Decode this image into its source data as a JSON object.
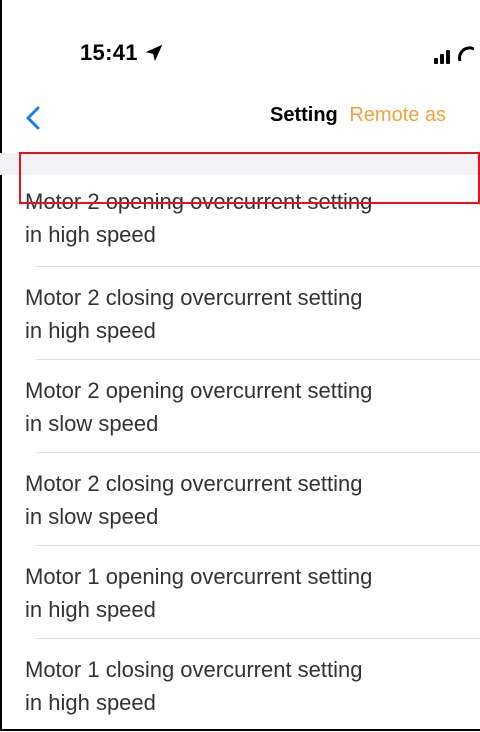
{
  "status_bar": {
    "time": "15:41",
    "location_icon": "location-arrow-icon",
    "signal_icon": "cellular-signal-icon"
  },
  "nav": {
    "back_icon": "chevron-left-icon",
    "title": "Setting",
    "subtitle": "Remote as"
  },
  "settings": [
    {
      "label": "Motor 2 opening overcurrent setting in high speed"
    },
    {
      "label": "Motor 2 closing overcurrent setting in high speed"
    },
    {
      "label": "Motor 2 opening overcurrent setting in slow speed"
    },
    {
      "label": "Motor 2 closing overcurrent setting in slow speed"
    },
    {
      "label": "Motor 1 opening overcurrent setting in high speed"
    },
    {
      "label": "Motor 1 closing overcurrent setting in high speed"
    }
  ],
  "colors": {
    "accent_back": "#1a7cf5",
    "subtitle": "#f2a23a",
    "highlight": "#e8141c"
  }
}
